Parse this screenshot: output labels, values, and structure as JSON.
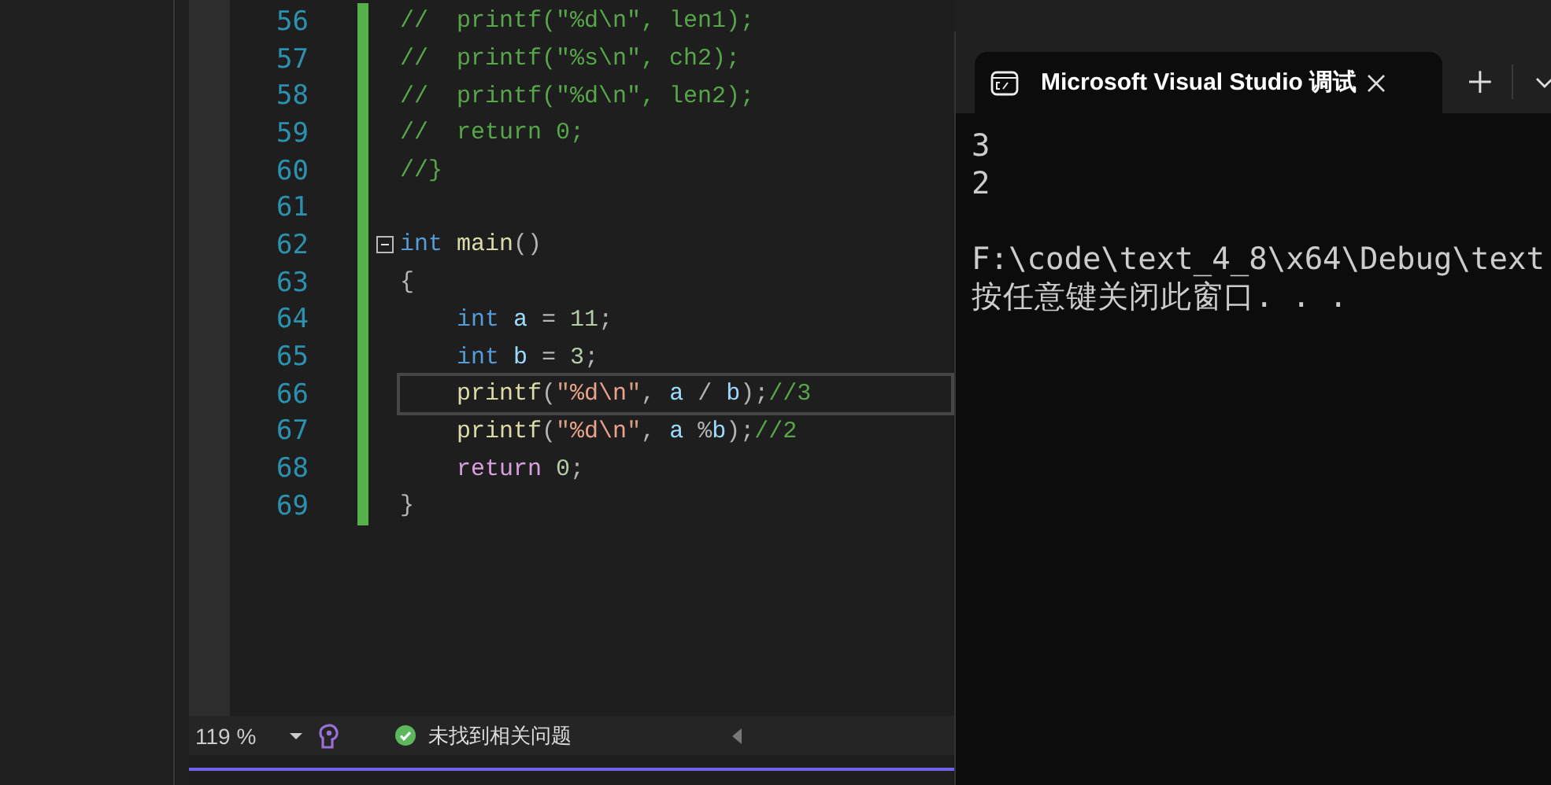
{
  "editor": {
    "lines": [
      {
        "number": "56",
        "changed": true,
        "current": false,
        "foldable": false,
        "tokens": [
          {
            "kind": "comment",
            "text": "//  printf(\"%d\\n\", len1);"
          }
        ]
      },
      {
        "number": "57",
        "changed": true,
        "current": false,
        "foldable": false,
        "tokens": [
          {
            "kind": "comment",
            "text": "//  printf(\"%s\\n\", ch2);"
          }
        ]
      },
      {
        "number": "58",
        "changed": true,
        "current": false,
        "foldable": false,
        "tokens": [
          {
            "kind": "comment",
            "text": "//  printf(\"%d\\n\", len2);"
          }
        ]
      },
      {
        "number": "59",
        "changed": true,
        "current": false,
        "foldable": false,
        "tokens": [
          {
            "kind": "comment",
            "text": "//  return 0;"
          }
        ]
      },
      {
        "number": "60",
        "changed": true,
        "current": false,
        "foldable": false,
        "tokens": [
          {
            "kind": "comment",
            "text": "//}"
          }
        ]
      },
      {
        "number": "61",
        "changed": true,
        "current": false,
        "foldable": false
      },
      {
        "number": "62",
        "changed": true,
        "current": false,
        "foldable": true,
        "tokens": [
          {
            "kind": "keyword",
            "text": "int"
          },
          {
            "kind": "function",
            "text": " main"
          },
          {
            "kind": "punct",
            "text": "()"
          }
        ]
      },
      {
        "number": "63",
        "changed": true,
        "current": false,
        "foldable": false,
        "tokens": [
          {
            "kind": "punct",
            "text": "{"
          }
        ]
      },
      {
        "number": "64",
        "changed": true,
        "current": false,
        "foldable": false,
        "tokens": [
          {
            "kind": "keyword",
            "text": "    int"
          },
          {
            "kind": "variable",
            "text": " a"
          },
          {
            "kind": "punct",
            "text": " = "
          },
          {
            "kind": "number",
            "text": "11"
          },
          {
            "kind": "punct",
            "text": ";"
          }
        ]
      },
      {
        "number": "65",
        "changed": true,
        "current": false,
        "foldable": false,
        "tokens": [
          {
            "kind": "keyword",
            "text": "    int"
          },
          {
            "kind": "variable",
            "text": " b"
          },
          {
            "kind": "punct",
            "text": " = "
          },
          {
            "kind": "number",
            "text": "3"
          },
          {
            "kind": "punct",
            "text": ";"
          }
        ]
      },
      {
        "number": "66",
        "changed": true,
        "current": true,
        "foldable": false,
        "tokens": [
          {
            "kind": "function",
            "text": "    printf"
          },
          {
            "kind": "punct",
            "text": "("
          },
          {
            "kind": "string",
            "text": "\""
          },
          {
            "kind": "escape",
            "text": "%d\\n"
          },
          {
            "kind": "string",
            "text": "\""
          },
          {
            "kind": "punct",
            "text": ", "
          },
          {
            "kind": "variable",
            "text": "a"
          },
          {
            "kind": "punct",
            "text": " / "
          },
          {
            "kind": "variable",
            "text": "b"
          },
          {
            "kind": "punct",
            "text": ");"
          },
          {
            "kind": "comment",
            "text": "//3"
          }
        ]
      },
      {
        "number": "67",
        "changed": true,
        "current": false,
        "foldable": false,
        "tokens": [
          {
            "kind": "function",
            "text": "    printf"
          },
          {
            "kind": "punct",
            "text": "("
          },
          {
            "kind": "string",
            "text": "\""
          },
          {
            "kind": "escape",
            "text": "%d\\n"
          },
          {
            "kind": "string",
            "text": "\""
          },
          {
            "kind": "punct",
            "text": ", "
          },
          {
            "kind": "variable",
            "text": "a"
          },
          {
            "kind": "punct",
            "text": " %"
          },
          {
            "kind": "variable",
            "text": "b"
          },
          {
            "kind": "punct",
            "text": ");"
          },
          {
            "kind": "comment",
            "text": "//2"
          }
        ]
      },
      {
        "number": "68",
        "changed": true,
        "current": false,
        "foldable": false,
        "tokens": [
          {
            "kind": "control",
            "text": "    return"
          },
          {
            "kind": "number",
            "text": " 0"
          },
          {
            "kind": "punct",
            "text": ";"
          }
        ]
      },
      {
        "number": "69",
        "changed": true,
        "current": false,
        "foldable": false,
        "tokens": [
          {
            "kind": "punct",
            "text": "}"
          }
        ]
      }
    ]
  },
  "status_bar": {
    "zoom": "119 %",
    "issues": "未找到相关问题"
  },
  "console": {
    "tab_title": "Microsoft Visual Studio 调试",
    "output": [
      "3",
      "2"
    ],
    "exit_message": [
      "F:\\code\\text_4_8\\x64\\Debug\\text",
      "按任意键关闭此窗口. . ."
    ]
  }
}
